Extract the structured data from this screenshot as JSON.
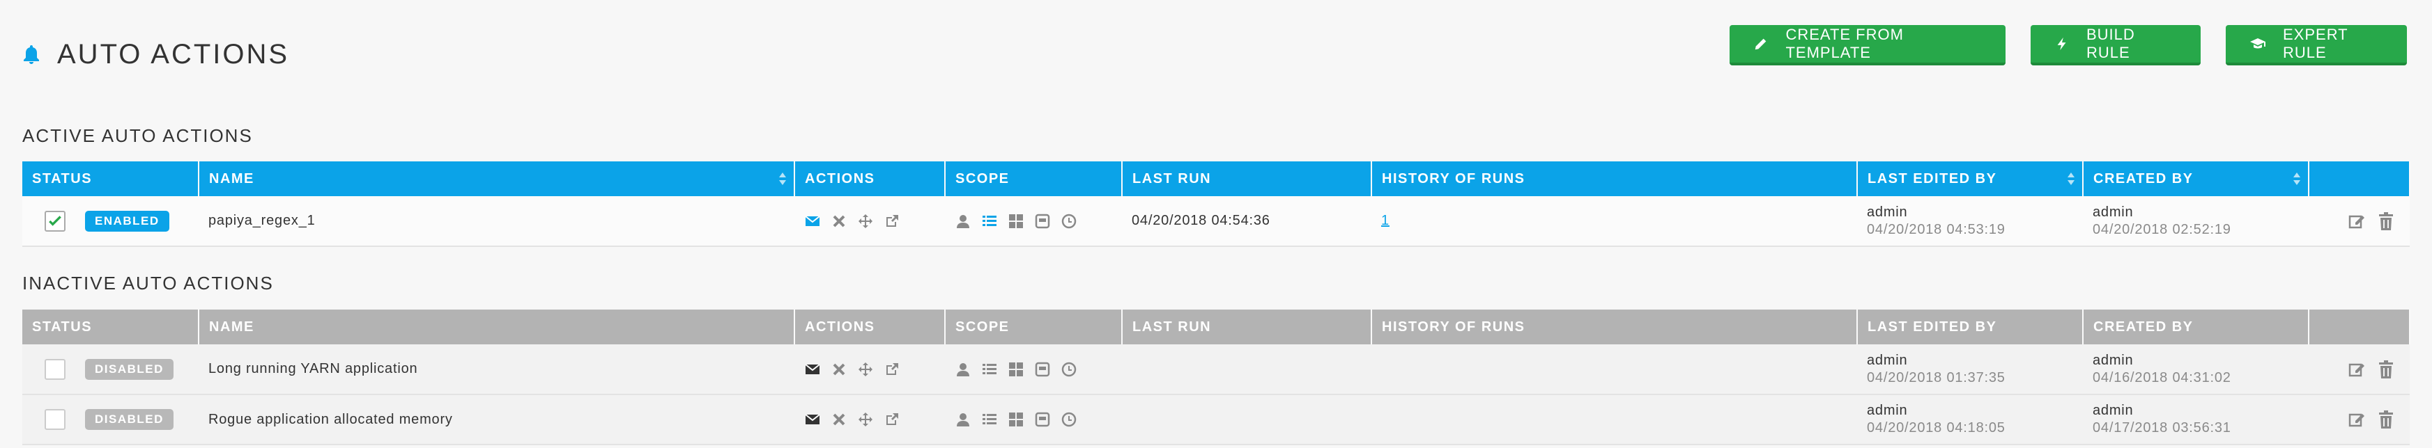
{
  "header": {
    "title": "AUTO ACTIONS"
  },
  "toolbar": {
    "create_from_template": "CREATE FROM TEMPLATE",
    "build_rule": "BUILD RULE",
    "expert_rule": "EXPERT RULE"
  },
  "columns": {
    "status": "STATUS",
    "name": "NAME",
    "actions": "ACTIONS",
    "scope": "SCOPE",
    "last_run": "LAST RUN",
    "history": "HISTORY OF RUNS",
    "last_edited_by": "LAST EDITED BY",
    "created_by": "CREATED BY"
  },
  "active": {
    "title": "ACTIVE AUTO ACTIONS",
    "rows": [
      {
        "checked": true,
        "status": "ENABLED",
        "name": "papiya_regex_1",
        "last_run": "04/20/2018 04:54:36",
        "history": "1",
        "edited_by": "admin",
        "edited_at": "04/20/2018 04:53:19",
        "created_by": "admin",
        "created_at": "04/20/2018 02:52:19"
      }
    ]
  },
  "inactive": {
    "title": "INACTIVE AUTO ACTIONS",
    "rows": [
      {
        "checked": false,
        "status": "DISABLED",
        "name": "Long running YARN application",
        "last_run": "",
        "history": "",
        "edited_by": "admin",
        "edited_at": "04/20/2018 01:37:35",
        "created_by": "admin",
        "created_at": "04/16/2018 04:31:02"
      },
      {
        "checked": false,
        "status": "DISABLED",
        "name": "Rogue application allocated memory",
        "last_run": "",
        "history": "",
        "edited_by": "admin",
        "edited_at": "04/20/2018 04:18:05",
        "created_by": "admin",
        "created_at": "04/17/2018 03:56:31"
      }
    ]
  },
  "colors": {
    "accent": "#0ba3e8",
    "button": "#27a84a",
    "inactive_header": "#b3b3b3"
  },
  "icons": {
    "action_icons": [
      "envelope-icon",
      "close-icon",
      "move-icon",
      "share-icon"
    ],
    "scope_icons": [
      "user-icon",
      "list-icon",
      "grid-icon",
      "calendar-icon",
      "clock-icon"
    ],
    "row_icons": [
      "edit-icon",
      "trash-icon"
    ]
  }
}
